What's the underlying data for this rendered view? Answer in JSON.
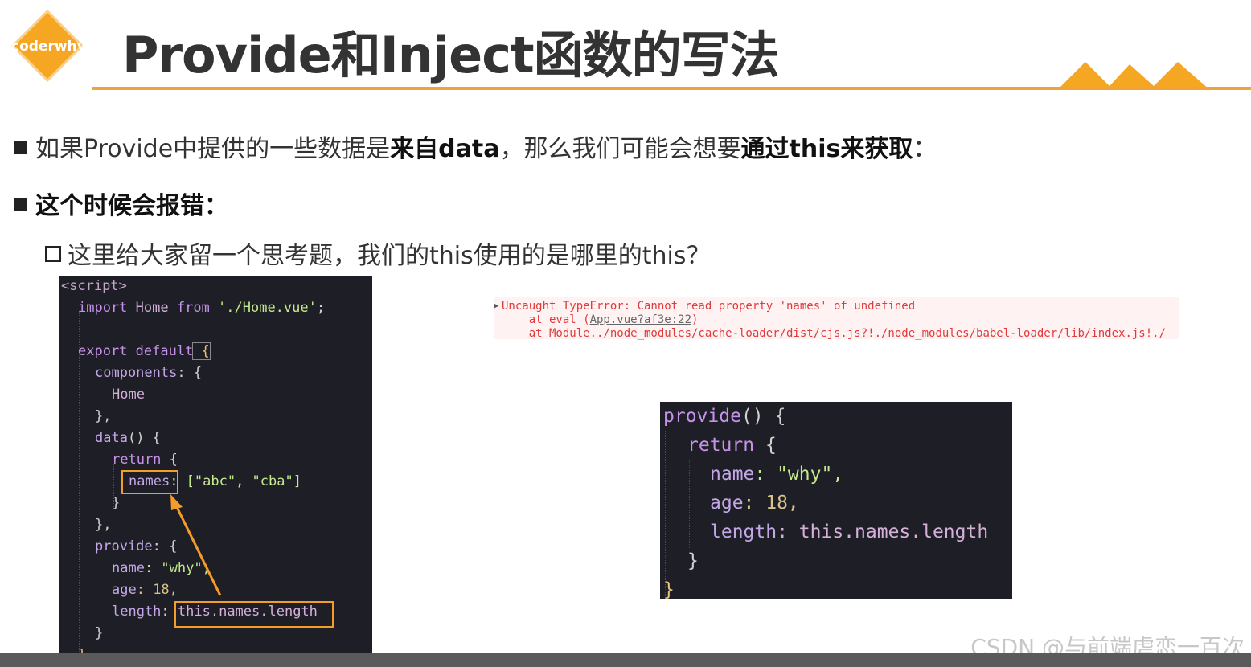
{
  "logo": {
    "text": "coderwhy",
    "color": "#f5a623"
  },
  "title": "Provide和Inject函数的写法",
  "accent_color": "#f0a33a",
  "bullets": {
    "b1_pre": "如果Provide中提供的一些数据是",
    "b1_bold1": "来自data",
    "b1_mid": "，那么我们可能会想要",
    "b1_bold2": "通过this来获取",
    "b1_end": "：",
    "b2": "这个时候会报错：",
    "b3": "这里给大家留一个思考题，我们的this使用的是哪里的this？"
  },
  "code_left": {
    "l1": "<script>",
    "l2_kw": "import",
    "l2_id": " Home ",
    "l2_kw2": "from",
    "l2_str": " './Home.vue'",
    "l2_end": ";",
    "l4_kw": "export default",
    "l4_br": " {",
    "l5": "components",
    "l5_end": ": {",
    "l6": "Home",
    "l7": "},",
    "l8": "data",
    "l8_end": "() {",
    "l9": "return",
    "l9_end": " {",
    "l10_prop": "names",
    "l10_end": ": [\"abc\", \"cba\"]",
    "l11": "}",
    "l12": "},",
    "l13": "provide",
    "l13_end": ": {",
    "l14_prop": "name",
    "l14_end": ": \"why\",",
    "l15_prop": "age",
    "l15_end": ": 18,",
    "l16_prop": "length",
    "l16_colon": ":",
    "l16_val": " this.names.length",
    "l17": "}",
    "l18": "}"
  },
  "error": {
    "line1": "Uncaught TypeError: Cannot read property 'names' of undefined",
    "line2_pre": "    at eval (",
    "line2_link": "App.vue?af3e:22",
    "line2_post": ")",
    "line3": "    at Module../node_modules/cache-loader/dist/cjs.js?!./node_modules/babel-loader/lib/index.js!./"
  },
  "code_right": {
    "l1": "provide",
    "l1_end": "() {",
    "l2": "return",
    "l2_end": " {",
    "l3_prop": "name",
    "l3_end": ": \"why\",",
    "l4_prop": "age",
    "l4_end": ": 18,",
    "l5_prop": "length",
    "l5_end": ": this.names.length",
    "l6": "}",
    "l7": "}"
  },
  "watermark": "CSDN @与前端虐恋一百次"
}
